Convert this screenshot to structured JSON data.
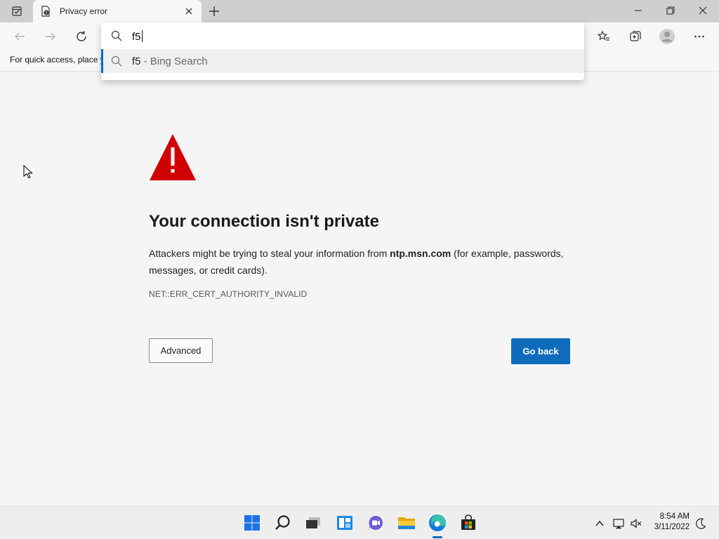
{
  "tab": {
    "title": "Privacy error"
  },
  "address_bar": {
    "query": "f5"
  },
  "suggestion": {
    "query": "f5",
    "separator": " - ",
    "source": "Bing Search"
  },
  "favorites_bar": {
    "hint": "For quick access, place y"
  },
  "error_page": {
    "title": "Your connection isn't private",
    "description_before": "Attackers might be trying to steal your information from ",
    "domain": "ntp.msn.com",
    "description_after": " (for example, passwords, messages, or credit cards).",
    "error_code": "NET::ERR_CERT_AUTHORITY_INVALID",
    "advanced_label": "Advanced",
    "go_back_label": "Go back"
  },
  "taskbar": {
    "time": "8:54 AM",
    "date": "3/11/2022",
    "apps": [
      "start-icon",
      "search-icon",
      "task-view-icon",
      "widgets-icon",
      "chat-icon",
      "file-explorer-icon",
      "edge-icon",
      "store-icon"
    ]
  },
  "colors": {
    "accent": "#0f6cbd",
    "warning_red": "#d10000"
  }
}
